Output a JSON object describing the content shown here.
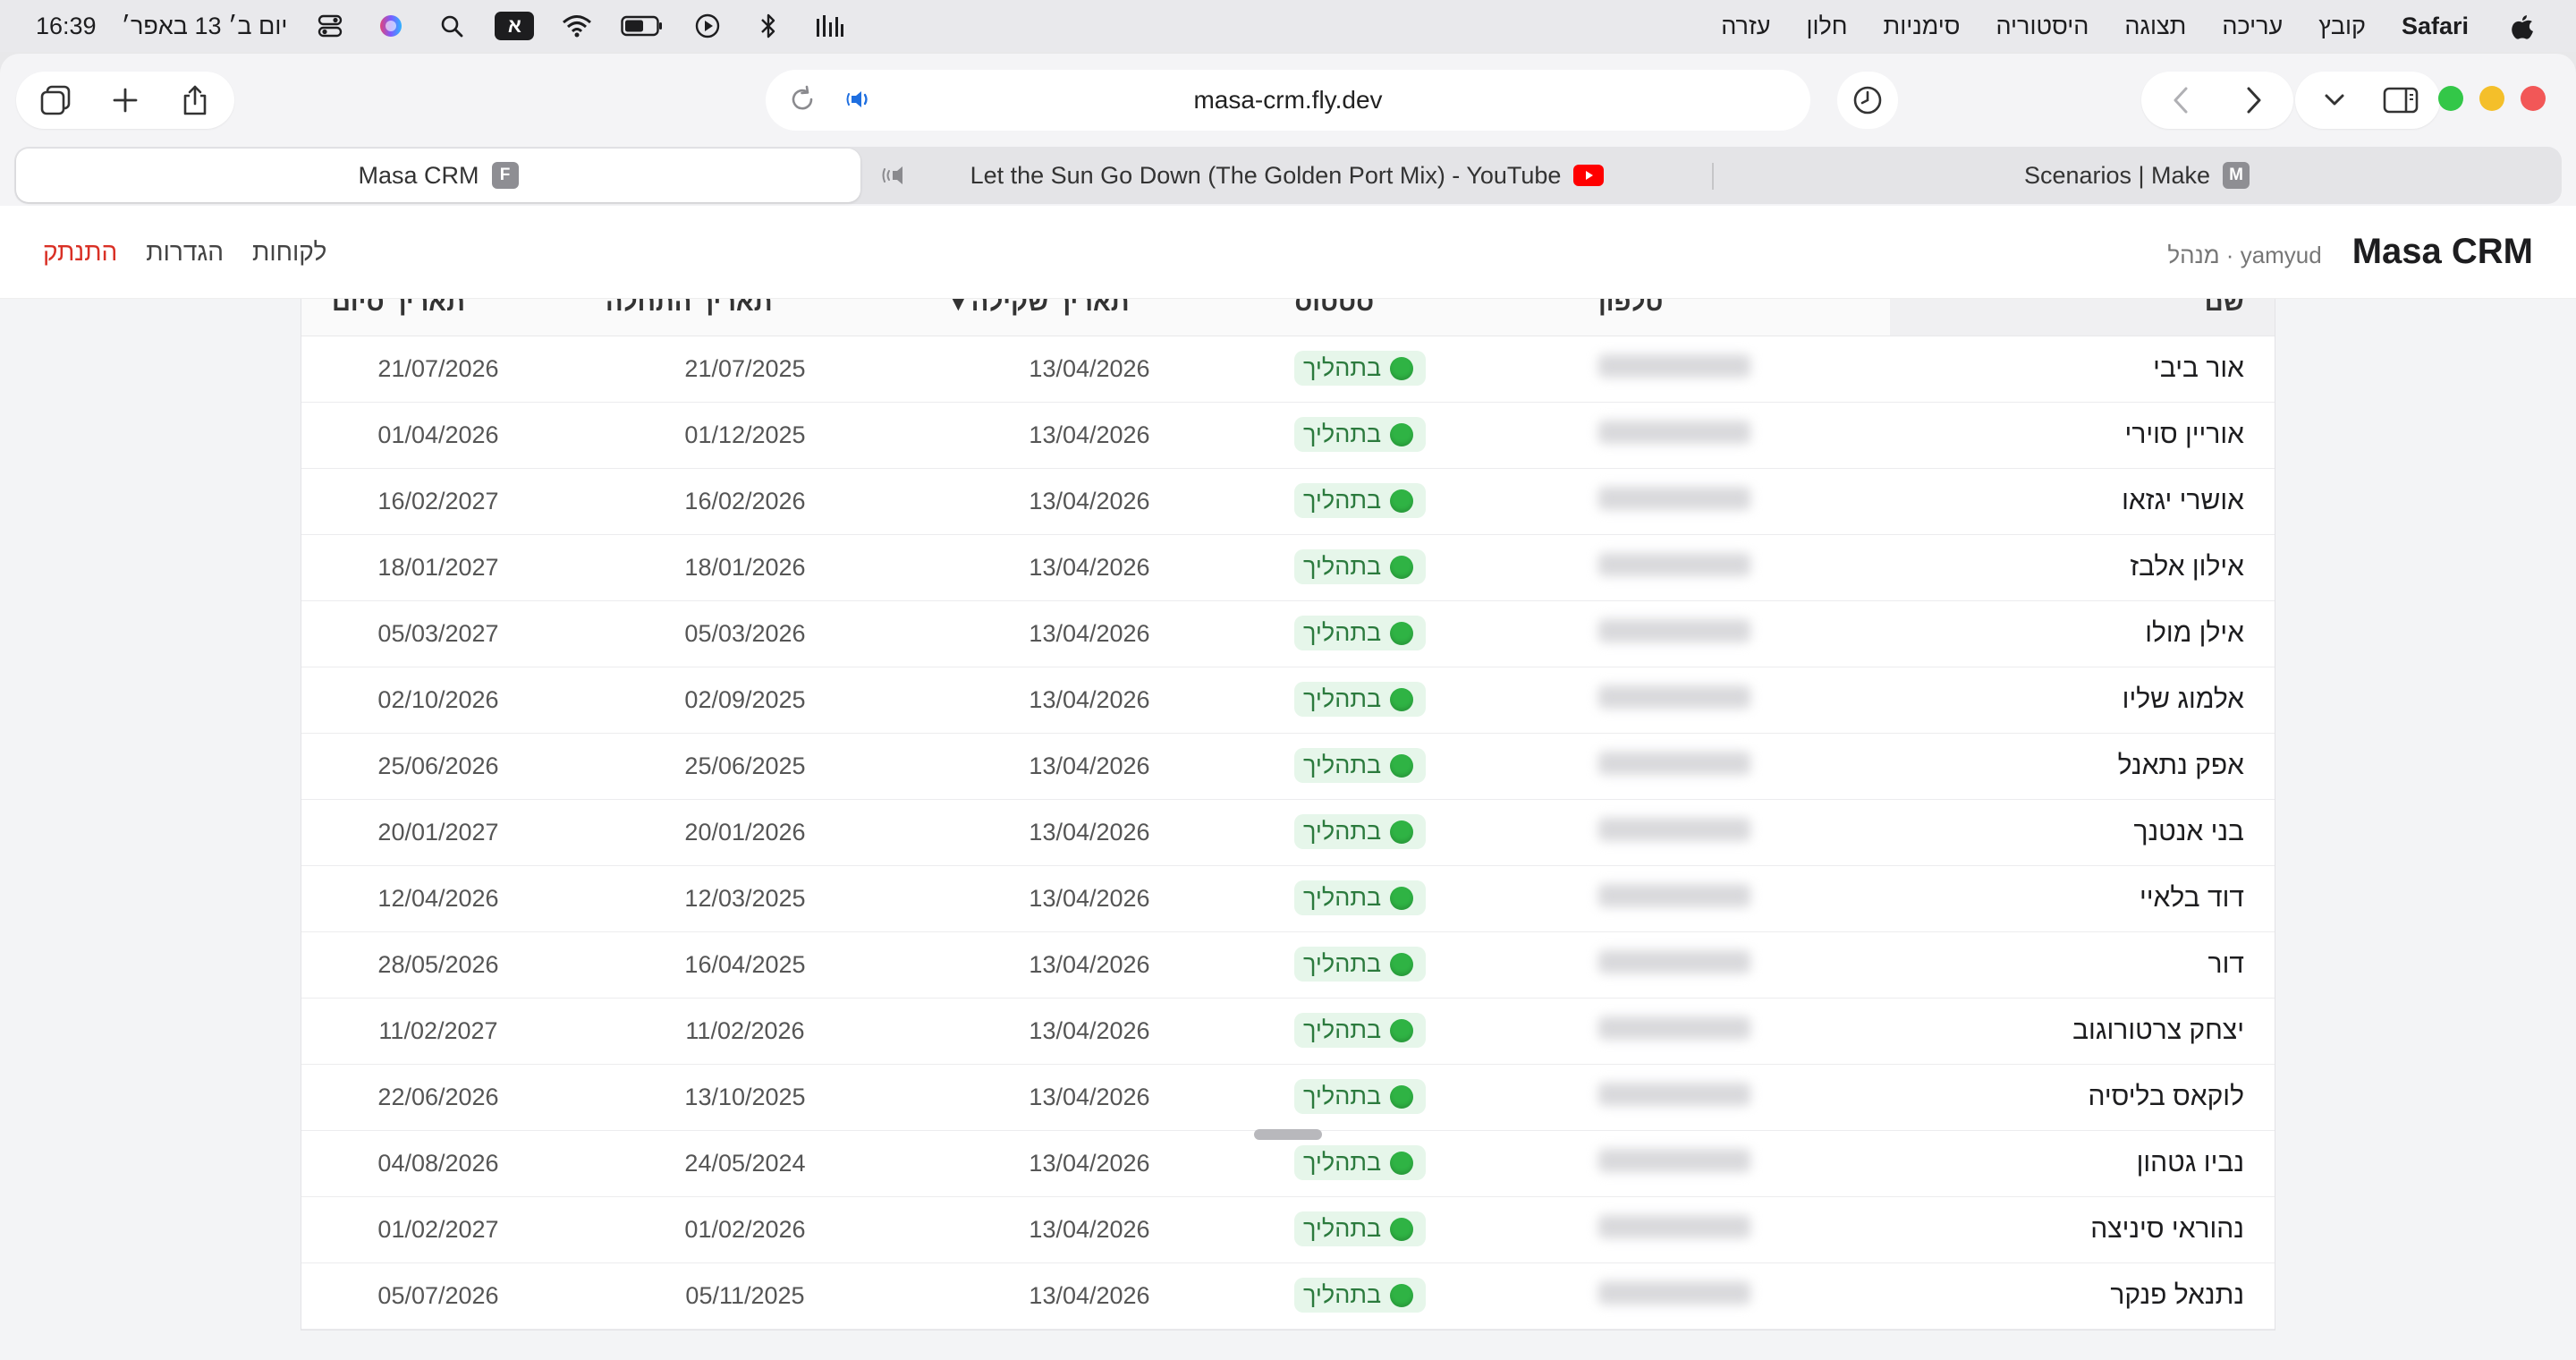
{
  "menubar": {
    "app": "Safari",
    "menus": [
      "קובץ",
      "עריכה",
      "תצוגה",
      "היסטוריה",
      "סימניות",
      "חלון",
      "עזרה"
    ],
    "input_badge": "א",
    "clock": "16:39",
    "date": "יום ב׳ 13 באפר׳"
  },
  "browser": {
    "url": "masa-crm.fly.dev",
    "tabs": [
      {
        "title": "Masa CRM",
        "favicon": "F"
      },
      {
        "title": "Let the Sun Go Down (The Golden Port Mix) - YouTube",
        "favicon": ""
      },
      {
        "title": "Scenarios | Make",
        "favicon": "M"
      }
    ]
  },
  "header": {
    "brand": "Masa CRM",
    "user": "yamyud · מנהל",
    "nav": {
      "customers": "לקוחות",
      "settings": "הגדרות",
      "logout": "התנתק"
    }
  },
  "table": {
    "columns": {
      "name": "שם",
      "phone": "טלפון",
      "status": "סטטוס",
      "weigh_date": "תאריך שקילה▼",
      "start_date": "תאריך התחלה",
      "end_date": "תאריך סיום"
    },
    "rows": [
      {
        "name": "אור ביבי",
        "status": "בתהליך",
        "weigh": "13/04/2026",
        "start": "21/07/2025",
        "end": "21/07/2026"
      },
      {
        "name": "אוריין סוירי",
        "status": "בתהליך",
        "weigh": "13/04/2026",
        "start": "01/12/2025",
        "end": "01/04/2026"
      },
      {
        "name": "אושרי יגזאו",
        "status": "בתהליך",
        "weigh": "13/04/2026",
        "start": "16/02/2026",
        "end": "16/02/2027"
      },
      {
        "name": "אילון אלבז",
        "status": "בתהליך",
        "weigh": "13/04/2026",
        "start": "18/01/2026",
        "end": "18/01/2027"
      },
      {
        "name": "אילן מולו",
        "status": "בתהליך",
        "weigh": "13/04/2026",
        "start": "05/03/2026",
        "end": "05/03/2027"
      },
      {
        "name": "אלמוג שליו",
        "status": "בתהליך",
        "weigh": "13/04/2026",
        "start": "02/09/2025",
        "end": "02/10/2026"
      },
      {
        "name": "אפק נתאנל",
        "status": "בתהליך",
        "weigh": "13/04/2026",
        "start": "25/06/2025",
        "end": "25/06/2026"
      },
      {
        "name": "בני אנטנך",
        "status": "בתהליך",
        "weigh": "13/04/2026",
        "start": "20/01/2026",
        "end": "20/01/2027"
      },
      {
        "name": "דוד בלאיי",
        "status": "בתהליך",
        "weigh": "13/04/2026",
        "start": "12/03/2025",
        "end": "12/04/2026"
      },
      {
        "name": "דור",
        "status": "בתהליך",
        "weigh": "13/04/2026",
        "start": "16/04/2025",
        "end": "28/05/2026"
      },
      {
        "name": "יצחק צרטורוגוב",
        "status": "בתהליך",
        "weigh": "13/04/2026",
        "start": "11/02/2026",
        "end": "11/02/2027"
      },
      {
        "name": "לוקאס בליסיה",
        "status": "בתהליך",
        "weigh": "13/04/2026",
        "start": "13/10/2025",
        "end": "22/06/2026"
      },
      {
        "name": "נביו גטהון",
        "status": "בתהליך",
        "weigh": "13/04/2026",
        "start": "24/05/2024",
        "end": "04/08/2026"
      },
      {
        "name": "נהוראי סיניצה",
        "status": "בתהליך",
        "weigh": "13/04/2026",
        "start": "01/02/2026",
        "end": "01/02/2027"
      },
      {
        "name": "נתנאל פנקר",
        "status": "בתהליך",
        "weigh": "13/04/2026",
        "start": "05/11/2025",
        "end": "05/07/2026"
      }
    ]
  },
  "colors": {
    "status_bg": "#e6f6ea",
    "status_dot": "#2fb344",
    "logout": "#d93025"
  }
}
